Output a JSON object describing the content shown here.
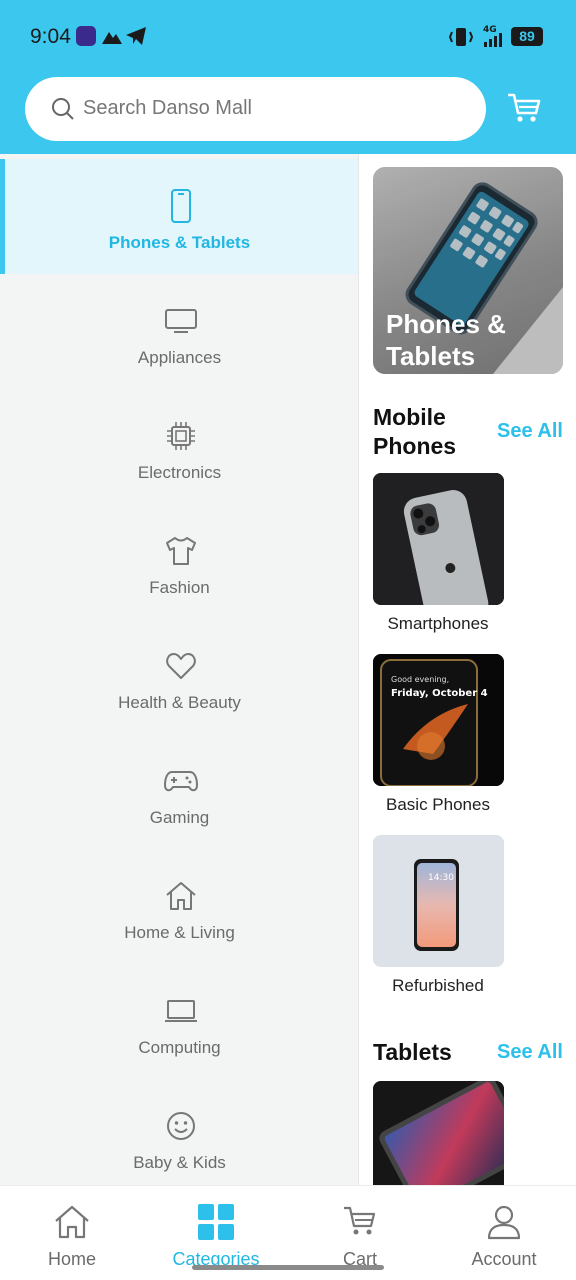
{
  "status": {
    "time": "9:04",
    "network": "4G",
    "battery": "89"
  },
  "search": {
    "placeholder": "Search Danso Mall"
  },
  "categories": [
    {
      "label": "Phones & Tablets",
      "icon": "phone-icon",
      "active": true
    },
    {
      "label": "Appliances",
      "icon": "monitor-icon",
      "active": false
    },
    {
      "label": "Electronics",
      "icon": "chip-icon",
      "active": false
    },
    {
      "label": "Fashion",
      "icon": "tshirt-icon",
      "active": false
    },
    {
      "label": "Health & Beauty",
      "icon": "heart-icon",
      "active": false
    },
    {
      "label": "Gaming",
      "icon": "gamepad-icon",
      "active": false
    },
    {
      "label": "Home & Living",
      "icon": "house-icon",
      "active": false
    },
    {
      "label": "Computing",
      "icon": "laptop-icon",
      "active": false
    },
    {
      "label": "Baby & Kids",
      "icon": "smiley-icon",
      "active": false
    }
  ],
  "panel": {
    "banner_title": "Phones & Tablets",
    "sections": [
      {
        "title": "Mobile Phones",
        "see_all": "See All",
        "items": [
          {
            "label": "Smartphones"
          },
          {
            "label": "Basic Phones"
          },
          {
            "label": "Refurbished"
          }
        ]
      },
      {
        "title": "Tablets",
        "see_all": "See All",
        "items": []
      }
    ]
  },
  "nav": [
    {
      "label": "Home",
      "icon": "home-icon",
      "active": false
    },
    {
      "label": "Categories",
      "icon": "grid-icon",
      "active": true
    },
    {
      "label": "Cart",
      "icon": "cart-icon",
      "active": false
    },
    {
      "label": "Account",
      "icon": "user-icon",
      "active": false
    }
  ],
  "colors": {
    "accent": "#3cc7ee",
    "accent_text": "#22b7e3",
    "rail_bg": "#f3f4f4",
    "active_bg": "#e2f6fc"
  }
}
